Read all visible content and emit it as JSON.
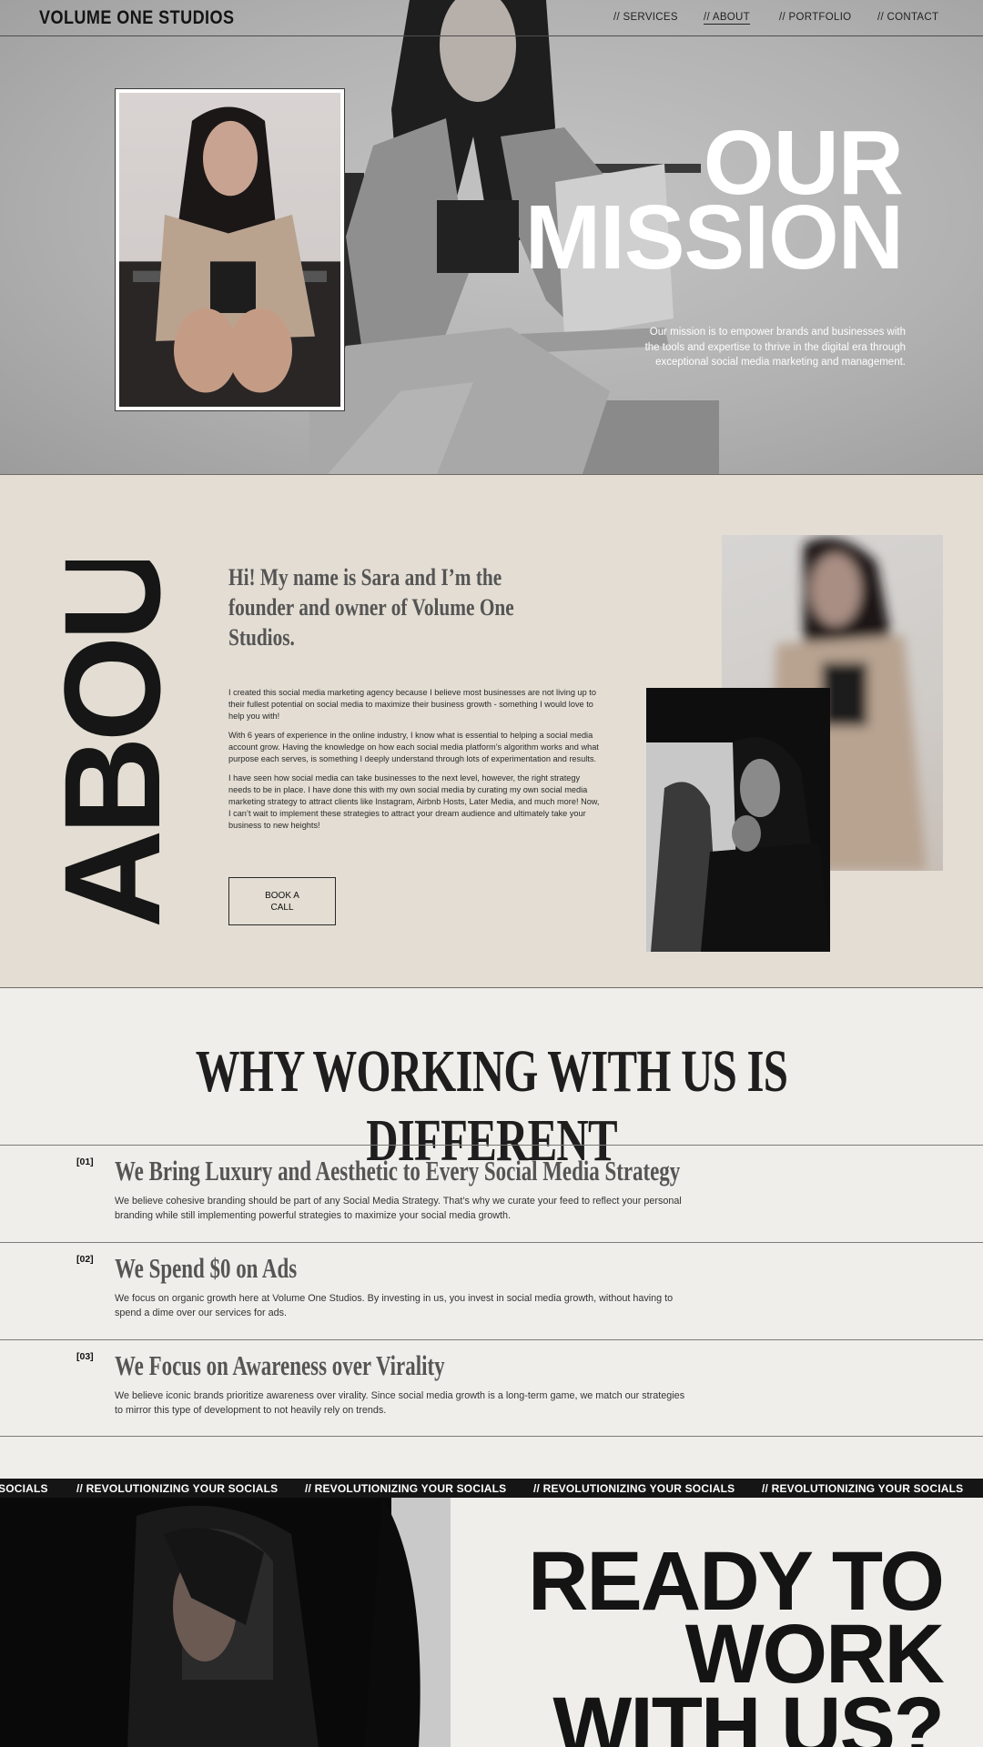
{
  "brand": {
    "logo": "VOLUME ONE STUDIOS"
  },
  "nav": {
    "items": [
      {
        "label": "// SERVICES"
      },
      {
        "label": "// ABOUT"
      },
      {
        "label": "// PORTFOLIO"
      },
      {
        "label": "// CONTACT"
      }
    ],
    "active": "// ABOUT"
  },
  "hero": {
    "title_line1": "OUR",
    "title_line2": "MISSION",
    "text": "Our mission is to empower brands and businesses with the tools and expertise to thrive in the digital era through exceptional social media marketing and management."
  },
  "about": {
    "vertical_word": "ABOUT",
    "heading": "Hi! My name is Sara and I’m the founder and owner of Volume One Studios.",
    "paragraphs": [
      "I created this social media marketing agency because I believe most businesses are not living up to their fullest potential on social media to maximize their business growth - something I would love to help you with!",
      "With 6 years of experience in the online industry, I know what is essential to helping a social media account grow. Having the knowledge on how each social media platform’s algorithm works and what purpose each serves, is something I deeply understand through lots of experimentation and results.",
      "I have seen how social media can take businesses to the next level, however, the right strategy needs to be in place. I have done this with my own social media by curating my own social media marketing strategy to attract clients like Instagram, Airbnb Hosts, Later Media, and much more! Now, I can’t wait to implement these strategies to attract your dream audience and ultimately take your business to new heights!"
    ],
    "button_label": "BOOK A CALL"
  },
  "why": {
    "title": "WHY WORKING WITH US IS DIFFERENT",
    "items": [
      {
        "num": "[01]",
        "heading": "We Bring Luxury and Aesthetic to Every Social Media Strategy",
        "text": "We believe cohesive branding should be part of any Social Media Strategy. That’s why we curate your feed to reflect your personal branding while still implementing powerful strategies to maximize your social media growth."
      },
      {
        "num": "[02]",
        "heading": "We Spend $0 on Ads",
        "text": "We focus on organic growth here at Volume One Studios. By investing in us, you invest in social media growth, without having to spend a dime over our services for ads."
      },
      {
        "num": "[03]",
        "heading": "We Focus on Awareness over Virality",
        "text": "We believe iconic brands prioritize awareness over virality. Since social media growth is a long-term game, we match our strategies to mirror this type of development to not heavily rely on trends."
      }
    ]
  },
  "marquee": {
    "first": "SOCIALS",
    "repeat": "// REVOLUTIONIZING YOUR SOCIALS"
  },
  "cta": {
    "line1": "READY TO",
    "line2": "WORK",
    "line3": "WITH US?"
  },
  "colors": {
    "about_bg": "#e3ddd3",
    "page_bg": "#efeeea",
    "ink": "#141414",
    "marquee_bg": "#151515"
  }
}
